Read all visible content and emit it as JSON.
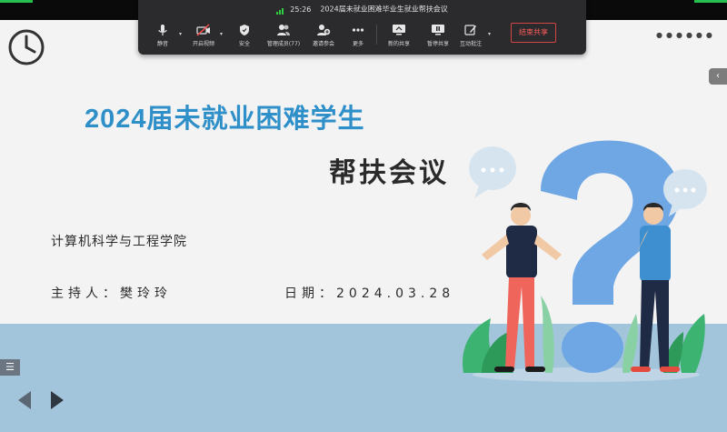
{
  "meeting": {
    "time": "25:26",
    "title": "2024届未就业困难毕业生就业帮扶会议",
    "tools": [
      {
        "label": "静音",
        "icon": "microphone-icon"
      },
      {
        "label": "开启视频",
        "icon": "video-off-icon"
      },
      {
        "label": "安全",
        "icon": "shield-icon"
      },
      {
        "label": "管理成员(77)",
        "icon": "members-icon"
      },
      {
        "label": "邀请参会",
        "icon": "invite-icon"
      },
      {
        "label": "更多",
        "icon": "more-icon"
      },
      {
        "label": "新的共享",
        "icon": "share-screen-icon"
      },
      {
        "label": "暂停共享",
        "icon": "pause-share-icon"
      },
      {
        "label": "互动批注",
        "icon": "annotate-icon"
      }
    ],
    "end_share": "结束共享",
    "accent_end": "#d64545",
    "signal_color": "#2ecc40"
  },
  "slide": {
    "title_line1": "2024届未就业困难学生",
    "title_line2": "帮扶会议",
    "department": "计算机科学与工程学院",
    "host": "主持人：樊玲玲",
    "date": "日期：2024.03.28",
    "title_color": "#2f8fc9"
  }
}
